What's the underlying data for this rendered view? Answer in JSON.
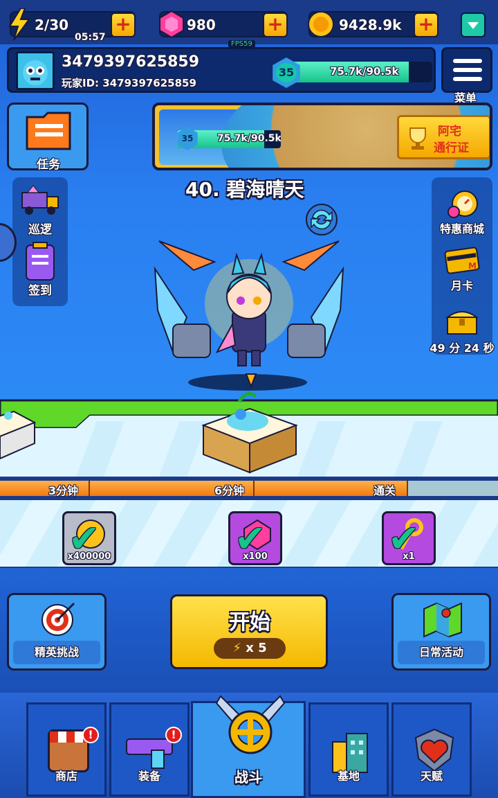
{
  "resources": {
    "energy": "2/30",
    "energy_timer": "05:57",
    "gems": "980",
    "coins": "9428.9k",
    "fps": "FPS59"
  },
  "player": {
    "name": "3479397625859",
    "id_label": "玩家ID: 3479397625859",
    "level": "35",
    "xp_text": "75.7k/90.5k",
    "xp_progress": 0.84
  },
  "menu": {
    "label": "菜单"
  },
  "battle_pass": {
    "level": "35",
    "xp_text": "75.7k/90.5k",
    "tag_line1": "阿宅",
    "tag_line2": "通行证"
  },
  "left_side": {
    "task": "任务",
    "patrol": "巡逻",
    "signin": "签到"
  },
  "right_side": {
    "shop_sale": "特惠商城",
    "monthly_card": "月卡",
    "chest_timer": "49 分 24 秒"
  },
  "stage": {
    "title": "40. 碧海晴天"
  },
  "progress": {
    "markers": [
      "3分钟",
      "6分钟",
      "通关"
    ]
  },
  "rewards": [
    {
      "icon": "gold-coin-icon",
      "qty": "x400000"
    },
    {
      "icon": "gem-icon",
      "qty": "x100"
    },
    {
      "icon": "key-icon",
      "qty": "x1"
    }
  ],
  "actions": {
    "elite": "精英挑战",
    "start": "开始",
    "start_cost": "x 5",
    "daily": "日常活动"
  },
  "nav": {
    "shop": "商店",
    "equip": "装备",
    "battle": "战斗",
    "base": "基地",
    "talent": "天赋",
    "alert_mark": "!"
  },
  "colors": {
    "accent_yellow": "#f5b800",
    "xp_green": "#17c38a",
    "alert_red": "#e41c1c",
    "bg_blue": "#2a7ff0"
  }
}
